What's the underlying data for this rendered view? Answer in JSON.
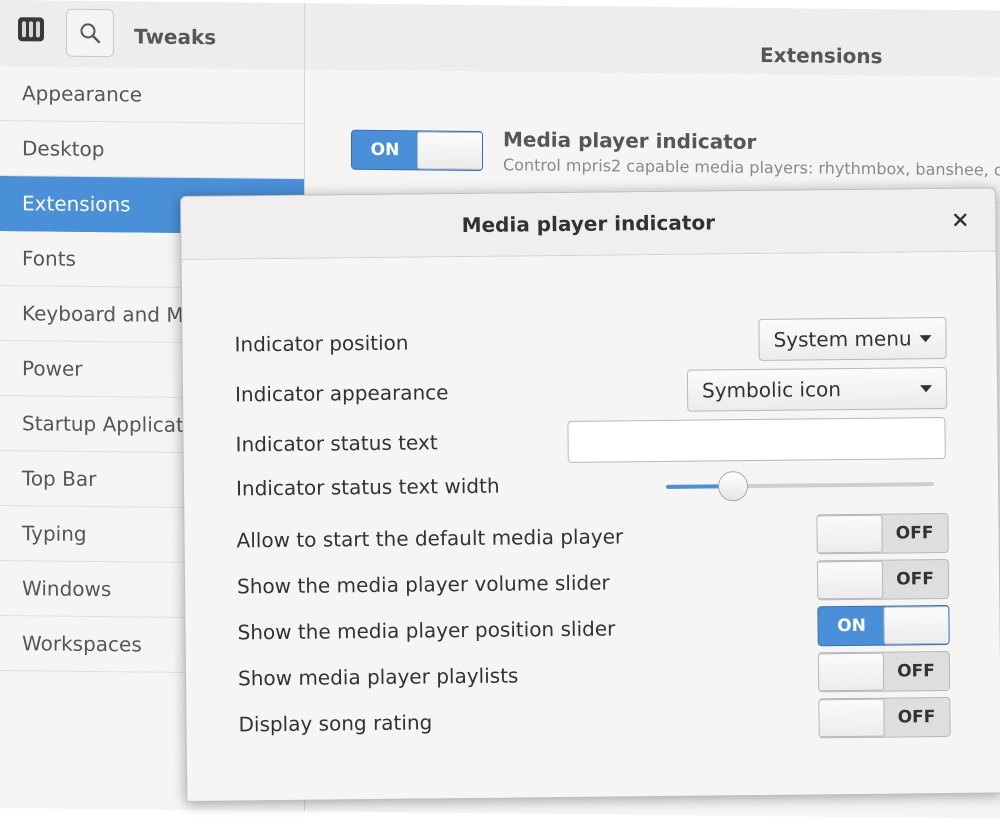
{
  "header": {
    "app_title": "Tweaks",
    "page_title": "Extensions",
    "icons": {
      "app": "tweaks-app-icon",
      "search": "search-icon"
    }
  },
  "sidebar": {
    "items": [
      {
        "label": "Appearance",
        "selected": false
      },
      {
        "label": "Desktop",
        "selected": false
      },
      {
        "label": "Extensions",
        "selected": true
      },
      {
        "label": "Fonts",
        "selected": false
      },
      {
        "label": "Keyboard and Mouse",
        "selected": false
      },
      {
        "label": "Power",
        "selected": false
      },
      {
        "label": "Startup Applications",
        "selected": false
      },
      {
        "label": "Top Bar",
        "selected": false
      },
      {
        "label": "Typing",
        "selected": false
      },
      {
        "label": "Windows",
        "selected": false
      },
      {
        "label": "Workspaces",
        "selected": false
      }
    ]
  },
  "extension": {
    "switch_label": "ON",
    "enabled": true,
    "name": "Media player indicator",
    "description": "Control mpris2 capable media players: rhythmbox, banshee, c"
  },
  "dialog": {
    "title": "Media player indicator",
    "close_icon": "close-icon",
    "position": {
      "label": "Indicator position",
      "value": "System menu"
    },
    "appearance": {
      "label": "Indicator appearance",
      "value": "Symbolic icon"
    },
    "status_text": {
      "label": "Indicator status text",
      "value": ""
    },
    "status_width": {
      "label": "Indicator status text width",
      "level": 0.25
    },
    "toggles": [
      {
        "label": "Allow to start the default media player",
        "state": "OFF"
      },
      {
        "label": "Show the media player volume slider",
        "state": "OFF"
      },
      {
        "label": "Show the media player position slider",
        "state": "ON"
      },
      {
        "label": "Show media player playlists",
        "state": "OFF"
      },
      {
        "label": "Display song rating",
        "state": "OFF"
      }
    ]
  },
  "colors": {
    "accent": "#4a90d9",
    "background": "#f6f5f4",
    "text": "#2e3436"
  }
}
